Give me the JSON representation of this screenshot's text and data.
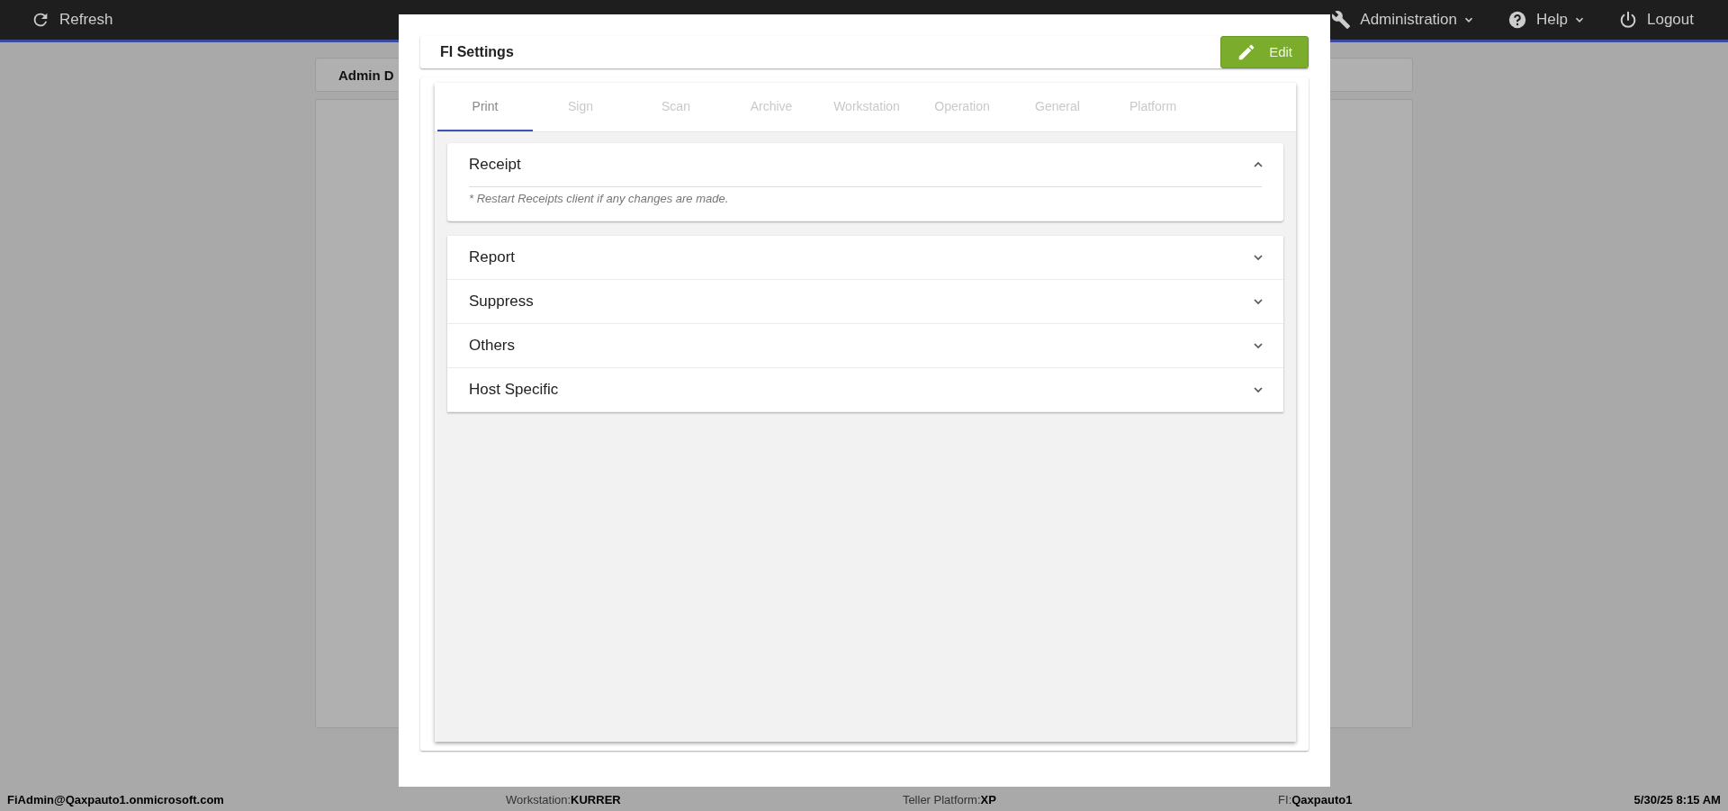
{
  "top_bar": {
    "refresh": "Refresh",
    "menus": [
      {
        "label": "Administration",
        "kind": "dropdown"
      },
      {
        "label": "Help",
        "kind": "dropdown"
      },
      {
        "label": "Logout",
        "kind": "plain"
      }
    ]
  },
  "background_card": {
    "title": "Admin D"
  },
  "dialog": {
    "title": "FI Settings",
    "edit_button": "Edit",
    "tabs": [
      {
        "label": "Print",
        "selected": true
      },
      {
        "label": "Sign",
        "selected": false
      },
      {
        "label": "Scan",
        "selected": false
      },
      {
        "label": "Archive",
        "selected": false
      },
      {
        "label": "Workstation",
        "selected": false
      },
      {
        "label": "Operation",
        "selected": false
      },
      {
        "label": "General",
        "selected": false
      },
      {
        "label": "Platform",
        "selected": false
      }
    ],
    "panels": [
      {
        "title": "Receipt",
        "expanded": true,
        "note": "* Restart Receipts client if any changes are made."
      },
      {
        "title": "Report",
        "expanded": false
      },
      {
        "title": "Suppress",
        "expanded": false
      },
      {
        "title": "Others",
        "expanded": false
      },
      {
        "title": "Host Specific",
        "expanded": false
      }
    ]
  },
  "status_bar": [
    {
      "value": "FiAdmin@Qaxpauto1.onmicrosoft.com"
    },
    {
      "label": "Workstation:",
      "value": "KURRER"
    },
    {
      "label": "Teller Platform:",
      "value": "XP"
    },
    {
      "label": "FI:",
      "value": "Qaxpauto1"
    },
    {
      "value": "5/30/25 8:15 AM"
    }
  ]
}
